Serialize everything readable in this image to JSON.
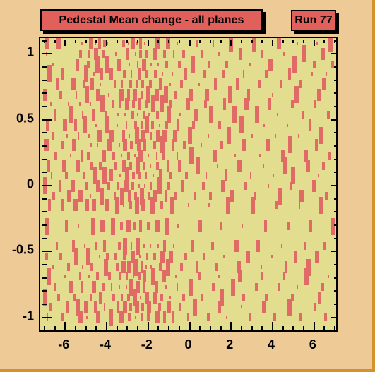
{
  "title": {
    "text": "Pedestal Mean change - all planes",
    "box_color": "#e2605c",
    "text_color": "#000000"
  },
  "run_label": {
    "text": "Run 77",
    "box_color": "#e2605c"
  },
  "colors": {
    "canvas_background": "#eecb96",
    "plot_background": "#e3dd90",
    "marker": "#e06a66",
    "frame": "#000000",
    "border": "#d4912f"
  },
  "chart_data": {
    "type": "scatter",
    "title": "Pedestal Mean change - all planes",
    "xlabel": "",
    "ylabel": "",
    "xlim": [
      -7.2,
      7.2
    ],
    "ylim": [
      -1.12,
      1.12
    ],
    "grid": false,
    "legend": null,
    "x_ticks": [
      -6,
      -4,
      -2,
      0,
      2,
      4,
      6
    ],
    "x_tick_labels": [
      "-6",
      "-4",
      "-2",
      "0",
      "2",
      "4",
      "6"
    ],
    "x_minor_step": 0.5,
    "y_ticks": [
      -1,
      -0.5,
      0,
      0.5,
      1
    ],
    "y_tick_labels": [
      "-1",
      "-0.5",
      "0",
      "0.5",
      "1"
    ],
    "y_minor_step": 0.1,
    "marker_style": "vertical-bar",
    "row_count": 26,
    "points": [
      {
        "row": 0,
        "y": 1.08,
        "xs": [
          -6.85,
          -6.3,
          -5.2,
          -4.75,
          -4.55,
          -4.35,
          -4.1,
          -3.95,
          -3.2,
          -2.95,
          -2.75,
          -2.55,
          -2.35,
          -2.15,
          -1.55,
          -1.05,
          -0.6,
          0.35,
          1.15,
          2.0,
          3.1,
          4.3,
          5.2,
          6.15,
          6.8
        ]
      },
      {
        "row": 1,
        "y": 1.0,
        "xs": [
          -6.9,
          -5.25,
          -4.85,
          -4.5,
          -4.15,
          -3.55,
          -3.0,
          -2.6,
          -2.35,
          -2.1,
          -1.7,
          -1.2,
          -0.75,
          -0.3,
          0.6,
          1.4,
          2.45,
          3.5,
          4.55,
          5.5,
          6.4
        ]
      },
      {
        "row": 2,
        "y": 0.92,
        "xs": [
          -6.6,
          -5.4,
          -4.9,
          -4.45,
          -4.0,
          -3.4,
          -2.9,
          -2.5,
          -2.2,
          -1.85,
          -1.5,
          -1.1,
          -0.5,
          0.15,
          0.95,
          1.8,
          2.9,
          3.9,
          5.05,
          6.0,
          6.9
        ]
      },
      {
        "row": 3,
        "y": 0.85,
        "xs": [
          -6.75,
          -6.1,
          -5.0,
          -4.6,
          -4.25,
          -3.8,
          -3.15,
          -2.8,
          -2.45,
          -2.05,
          -1.65,
          -1.3,
          -0.85,
          -0.2,
          0.7,
          1.6,
          2.6,
          3.7,
          4.8,
          5.9,
          6.6
        ]
      },
      {
        "row": 4,
        "y": 0.77,
        "xs": [
          -6.4,
          -5.6,
          -5.1,
          -4.7,
          -4.3,
          -3.6,
          -3.25,
          -2.85,
          -2.55,
          -2.25,
          -1.9,
          -1.4,
          -0.95,
          -0.4,
          0.45,
          1.25,
          2.3,
          3.35,
          4.4,
          5.35,
          6.5
        ]
      },
      {
        "row": 5,
        "y": 0.69,
        "xs": [
          -6.95,
          -6.2,
          -5.45,
          -4.95,
          -4.4,
          -3.9,
          -3.3,
          -2.95,
          -2.65,
          -2.3,
          -2.0,
          -1.6,
          -1.15,
          -0.65,
          0.05,
          0.85,
          1.95,
          2.85,
          4.0,
          5.15,
          6.25
        ]
      },
      {
        "row": 6,
        "y": 0.62,
        "xs": [
          -6.7,
          -5.85,
          -5.3,
          -4.8,
          -4.2,
          -3.7,
          -3.35,
          -3.0,
          -2.7,
          -2.4,
          -2.1,
          -1.75,
          -1.35,
          -0.9,
          -0.1,
          0.75,
          1.7,
          2.75,
          3.85,
          4.95,
          6.05
        ]
      },
      {
        "row": 7,
        "y": 0.54,
        "xs": [
          -6.5,
          -5.7,
          -5.15,
          -4.65,
          -4.05,
          -3.45,
          -3.1,
          -2.75,
          -2.5,
          -2.2,
          -1.95,
          -1.55,
          -1.0,
          -0.45,
          0.3,
          1.05,
          2.15,
          3.25,
          4.25,
          5.45,
          6.7
        ]
      },
      {
        "row": 8,
        "y": 0.46,
        "xs": [
          -6.85,
          -6.0,
          -5.5,
          -5.05,
          -4.5,
          -3.95,
          -3.5,
          -3.05,
          -2.6,
          -2.3,
          -2.05,
          -1.8,
          -1.45,
          -1.1,
          -0.55,
          0.2,
          1.45,
          2.5,
          3.6,
          4.7,
          5.8
        ]
      },
      {
        "row": 9,
        "y": 0.38,
        "xs": [
          -6.6,
          -5.9,
          -5.35,
          -4.85,
          -4.35,
          -3.75,
          -3.2,
          -2.9,
          -2.55,
          -2.25,
          -1.85,
          -1.5,
          -1.2,
          -0.7,
          0.0,
          0.9,
          1.9,
          3.0,
          4.15,
          5.25,
          6.35
        ]
      },
      {
        "row": 10,
        "y": 0.31,
        "xs": [
          -6.9,
          -6.15,
          -5.55,
          -4.75,
          -4.45,
          -3.85,
          -3.4,
          -3.1,
          -2.8,
          -2.45,
          -2.15,
          -1.7,
          -1.3,
          -0.8,
          -0.25,
          0.55,
          1.55,
          2.65,
          3.75,
          4.85,
          6.1
        ]
      },
      {
        "row": 11,
        "y": 0.23,
        "xs": [
          -6.45,
          -5.75,
          -5.2,
          -4.9,
          -4.15,
          -3.65,
          -3.3,
          -2.95,
          -2.65,
          -2.35,
          -2.0,
          -1.6,
          -1.25,
          -0.6,
          0.1,
          1.2,
          2.2,
          3.4,
          4.5,
          5.6,
          6.75
        ]
      },
      {
        "row": 12,
        "y": 0.15,
        "xs": [
          -6.8,
          -6.05,
          -5.4,
          -4.7,
          -4.3,
          -3.55,
          -3.15,
          -2.85,
          -2.5,
          -2.2,
          -1.9,
          -1.55,
          -1.05,
          -0.5,
          0.4,
          1.35,
          2.4,
          3.55,
          4.6,
          5.7,
          6.45
        ]
      },
      {
        "row": 13,
        "y": 0.08,
        "xs": [
          -6.65,
          -5.95,
          -5.1,
          -4.55,
          -4.1,
          -3.8,
          -3.35,
          -3.0,
          -2.7,
          -2.4,
          -2.1,
          -1.75,
          -1.4,
          -0.95,
          -0.15,
          0.8,
          1.75,
          2.95,
          4.05,
          5.0,
          6.2
        ]
      },
      {
        "row": 14,
        "y": 0.0,
        "xs": [
          -6.95,
          -6.25,
          -5.65,
          -5.0,
          -4.4,
          -3.9,
          -3.45,
          -3.05,
          -2.75,
          -2.45,
          -2.15,
          -1.85,
          -1.45,
          -1.0,
          -0.35,
          0.65,
          1.6,
          2.7,
          3.8,
          4.9,
          6.0
        ]
      },
      {
        "row": 15,
        "y": -0.08,
        "xs": [
          -6.55,
          -5.8,
          -5.25,
          -4.8,
          -4.25,
          -3.6,
          -3.25,
          -2.9,
          -2.6,
          -2.3,
          -1.95,
          -1.65,
          -1.15,
          -0.7,
          0.25,
          1.0,
          2.05,
          3.15,
          4.35,
          5.4,
          6.6
        ]
      },
      {
        "row": 16,
        "y": -0.15,
        "xs": [
          -6.75,
          -6.1,
          -5.5,
          -4.95,
          -4.6,
          -4.0,
          -3.5,
          -3.2,
          -2.85,
          -2.55,
          -2.25,
          -1.8,
          -1.35,
          -0.85,
          -0.05,
          0.95,
          1.85,
          3.05,
          4.2,
          5.3,
          6.3
        ]
      },
      {
        "row": 17,
        "y": -0.31,
        "xs": [
          -6.85,
          -5.95,
          -5.35,
          -4.65,
          -4.2,
          -3.7,
          -3.3,
          -2.95,
          -2.65,
          -2.35,
          -2.0,
          -1.55,
          -1.1,
          -0.55,
          0.5,
          1.5,
          2.55,
          3.65,
          4.75,
          5.85,
          6.9
        ]
      },
      {
        "row": 18,
        "y": -0.46,
        "xs": [
          -6.4,
          -5.6,
          -5.05,
          -4.5,
          -4.1,
          -3.4,
          -3.1,
          -2.8,
          -2.5,
          -2.2,
          -1.9,
          -1.5,
          -1.2,
          -0.75,
          0.15,
          1.1,
          2.25,
          3.3,
          4.45,
          5.55,
          6.5
        ]
      },
      {
        "row": 19,
        "y": -0.54,
        "xs": [
          -6.9,
          -6.2,
          -5.45,
          -4.9,
          -4.35,
          -3.95,
          -3.55,
          -3.15,
          -2.75,
          -2.4,
          -2.05,
          -1.7,
          -1.3,
          -0.9,
          -0.2,
          0.7,
          1.65,
          2.8,
          3.95,
          5.1,
          6.15
        ]
      },
      {
        "row": 20,
        "y": -0.62,
        "xs": [
          -6.6,
          -5.85,
          -5.15,
          -4.7,
          -4.05,
          -3.5,
          -3.2,
          -2.9,
          -2.6,
          -2.3,
          -2.1,
          -1.85,
          -1.4,
          -1.05,
          -0.4,
          0.35,
          1.3,
          2.35,
          3.45,
          4.65,
          5.75
        ]
      },
      {
        "row": 21,
        "y": -0.69,
        "xs": [
          -6.8,
          -6.0,
          -5.3,
          -4.85,
          -4.45,
          -3.85,
          -3.35,
          -3.0,
          -2.7,
          -2.45,
          -2.15,
          -1.75,
          -1.25,
          -0.65,
          0.45,
          1.4,
          2.45,
          3.5,
          4.55,
          5.65,
          6.7
        ]
      },
      {
        "row": 22,
        "y": -0.77,
        "xs": [
          -6.5,
          -5.7,
          -5.2,
          -4.6,
          -4.15,
          -3.75,
          -3.4,
          -3.05,
          -2.8,
          -2.5,
          -2.2,
          -1.6,
          -1.15,
          -0.6,
          0.05,
          1.15,
          2.1,
          3.2,
          4.3,
          5.2,
          6.4
        ]
      },
      {
        "row": 23,
        "y": -0.85,
        "xs": [
          -6.95,
          -6.3,
          -5.55,
          -4.75,
          -4.3,
          -3.65,
          -3.25,
          -2.95,
          -2.65,
          -2.35,
          -2.05,
          -1.65,
          -1.35,
          -0.95,
          -0.3,
          0.6,
          1.55,
          2.6,
          3.7,
          4.95,
          6.25
        ]
      },
      {
        "row": 24,
        "y": -0.92,
        "xs": [
          -6.7,
          -5.9,
          -5.4,
          -5.0,
          -4.55,
          -4.1,
          -3.45,
          -3.1,
          -2.85,
          -2.55,
          -2.25,
          -1.95,
          -1.45,
          -1.0,
          -0.45,
          0.25,
          1.45,
          2.5,
          3.6,
          4.8,
          6.05
        ]
      },
      {
        "row": 25,
        "y": -1.0,
        "xs": [
          -6.85,
          -6.1,
          -5.25,
          -4.95,
          -4.4,
          -3.8,
          -3.3,
          -2.9,
          -2.6,
          -2.3,
          -2.0,
          -1.55,
          -1.2,
          -0.8,
          -0.1,
          0.9,
          1.8,
          2.9,
          4.1,
          5.35,
          6.55
        ]
      }
    ]
  }
}
